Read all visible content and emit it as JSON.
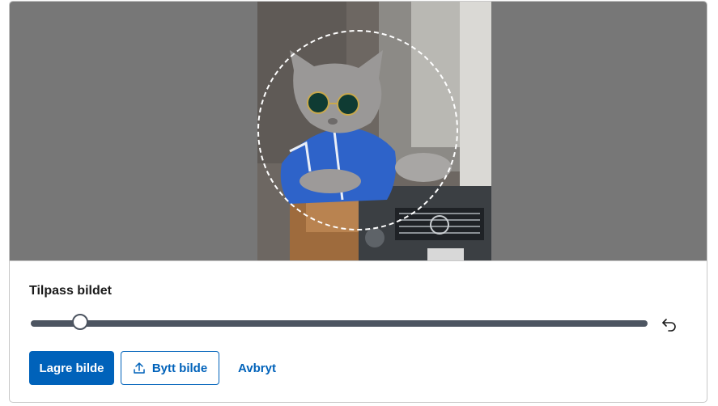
{
  "editor": {
    "title": "Tilpass bildet",
    "zoom_level": 0.08,
    "save_label": "Lagre bilde",
    "change_label": "Bytt bilde",
    "cancel_label": "Avbryt"
  },
  "icons": {
    "reset": "undo-icon",
    "upload": "upload-icon"
  },
  "colors": {
    "primary": "#0062ba",
    "slider_track": "#4d5561",
    "overlay": "#777777"
  }
}
